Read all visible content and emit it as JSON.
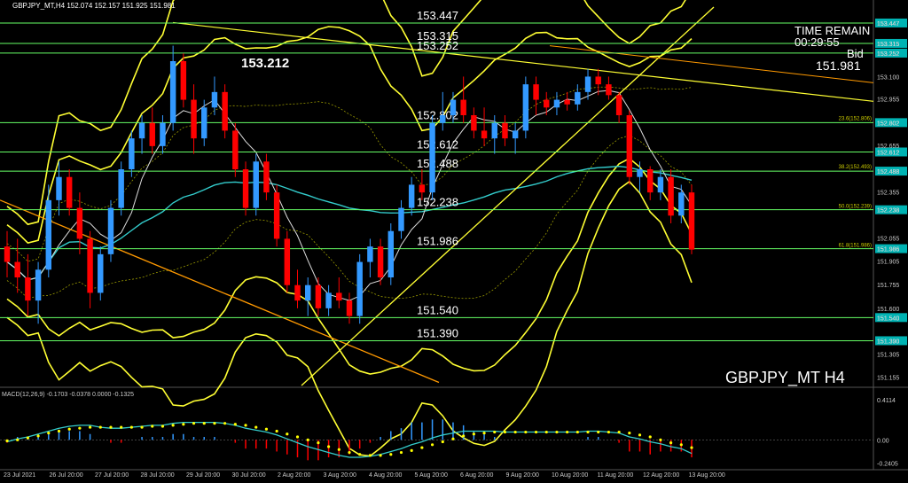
{
  "header": {
    "symbol_line": "GBPJPY_MT,H4  152.074 152.157 151.925 151.981"
  },
  "overlay": {
    "time_remain_label": "TIME REMAIN",
    "time_remain_value": "00:29:55",
    "bid_label": "Bid",
    "bid_value": "151.981",
    "highlight_price": "153.212",
    "watermark": "GBPJPY_MT H4"
  },
  "macd_header": "MACD(12,26,9) -0.1703 -0.0378 0.0000 -0.1325",
  "colors": {
    "bull": "#3399ff",
    "bear": "#ff0000",
    "bollinger": "#ffff33",
    "ma_cyan": "#33cccc",
    "level_line": "#66ff66",
    "level_tag_bg": "#00b3b3",
    "trend_orange": "#ff9900",
    "macd_signal": "#ffff00"
  },
  "chart_data": [
    {
      "type": "candlestick",
      "title": "GBPJPY_MT H4",
      "ylim": [
        151.1,
        153.55
      ],
      "y_ticks": [
        "153.447",
        "153.315",
        "153.252",
        "153.100",
        "152.955",
        "152.802",
        "152.655",
        "152.612",
        "152.488",
        "152.355",
        "152.238",
        "152.055",
        "151.986",
        "151.905",
        "151.755",
        "151.600",
        "151.540",
        "151.390",
        "151.305",
        "151.155"
      ],
      "x_ticks": [
        "23 Jul 2021",
        "26 Jul 20:00",
        "27 Jul 20:00",
        "28 Jul 20:00",
        "29 Jul 20:00",
        "30 Jul 20:00",
        "2 Aug 20:00",
        "3 Aug 20:00",
        "4 Aug 20:00",
        "5 Aug 20:00",
        "6 Aug 20:00",
        "9 Aug 20:00",
        "10 Aug 20:00",
        "11 Aug 20:00",
        "12 Aug 20:00",
        "13 Aug 20:00"
      ],
      "price_levels": [
        {
          "price": 153.447,
          "label": "153.447"
        },
        {
          "price": 153.315,
          "label": "153.315"
        },
        {
          "price": 153.252,
          "label": "153.252"
        },
        {
          "price": 152.802,
          "label": "152.802"
        },
        {
          "price": 152.612,
          "label": "152.612"
        },
        {
          "price": 152.488,
          "label": "152.488"
        },
        {
          "price": 152.238,
          "label": "152.238"
        },
        {
          "price": 151.986,
          "label": "151.986"
        },
        {
          "price": 151.54,
          "label": "151.540"
        },
        {
          "price": 151.39,
          "label": "151.390"
        }
      ],
      "fib_labels": [
        {
          "price": 152.806,
          "label": "23.6(152.806)"
        },
        {
          "price": 152.493,
          "label": "38.2(152.493)"
        },
        {
          "price": 152.239,
          "label": "50.0(152.239)"
        },
        {
          "price": 151.986,
          "label": "61.8(151.986)"
        }
      ],
      "candles": [
        [
          152.0,
          152.1,
          151.8,
          151.9
        ],
        [
          151.9,
          152.05,
          151.7,
          151.8
        ],
        [
          151.8,
          151.95,
          151.55,
          151.65
        ],
        [
          151.65,
          151.9,
          151.5,
          151.85
        ],
        [
          151.85,
          152.4,
          151.8,
          152.3
        ],
        [
          152.3,
          152.55,
          152.2,
          152.45
        ],
        [
          152.45,
          152.5,
          152.2,
          152.25
        ],
        [
          152.25,
          152.35,
          151.95,
          152.05
        ],
        [
          152.05,
          152.1,
          151.6,
          151.7
        ],
        [
          151.7,
          152.0,
          151.65,
          151.95
        ],
        [
          151.95,
          152.3,
          151.9,
          152.25
        ],
        [
          152.25,
          152.55,
          152.2,
          152.5
        ],
        [
          152.5,
          152.75,
          152.45,
          152.7
        ],
        [
          152.7,
          152.85,
          152.6,
          152.8
        ],
        [
          152.8,
          152.9,
          152.6,
          152.65
        ],
        [
          152.65,
          152.85,
          152.6,
          152.8
        ],
        [
          152.8,
          153.3,
          152.75,
          153.2
        ],
        [
          153.2,
          153.25,
          152.9,
          152.95
        ],
        [
          152.95,
          153.05,
          152.6,
          152.7
        ],
        [
          152.7,
          152.95,
          152.65,
          152.9
        ],
        [
          152.9,
          153.1,
          152.85,
          153.0
        ],
        [
          153.0,
          153.05,
          152.7,
          152.75
        ],
        [
          152.75,
          152.8,
          152.45,
          152.5
        ],
        [
          152.5,
          152.55,
          152.2,
          152.25
        ],
        [
          152.25,
          152.6,
          152.2,
          152.55
        ],
        [
          152.55,
          152.6,
          152.3,
          152.35
        ],
        [
          152.35,
          152.4,
          152.0,
          152.05
        ],
        [
          152.05,
          152.1,
          151.7,
          151.75
        ],
        [
          151.75,
          151.85,
          151.6,
          151.65
        ],
        [
          151.65,
          151.8,
          151.55,
          151.75
        ],
        [
          151.75,
          151.8,
          151.55,
          151.6
        ],
        [
          151.6,
          151.75,
          151.55,
          151.7
        ],
        [
          151.7,
          151.8,
          151.6,
          151.65
        ],
        [
          151.65,
          151.7,
          151.5,
          151.55
        ],
        [
          151.55,
          151.95,
          151.5,
          151.9
        ],
        [
          151.9,
          152.05,
          151.8,
          152.0
        ],
        [
          152.0,
          152.05,
          151.75,
          151.8
        ],
        [
          151.8,
          152.15,
          151.75,
          152.1
        ],
        [
          152.1,
          152.3,
          152.05,
          152.25
        ],
        [
          152.25,
          152.45,
          152.2,
          152.4
        ],
        [
          152.4,
          152.5,
          152.3,
          152.35
        ],
        [
          152.35,
          152.85,
          152.3,
          152.8
        ],
        [
          152.8,
          153.0,
          152.75,
          152.85
        ],
        [
          152.85,
          153.0,
          152.8,
          152.95
        ],
        [
          152.95,
          153.1,
          152.8,
          152.85
        ],
        [
          152.85,
          152.9,
          152.7,
          152.75
        ],
        [
          152.75,
          152.9,
          152.65,
          152.7
        ],
        [
          152.7,
          152.85,
          152.6,
          152.8
        ],
        [
          152.8,
          152.85,
          152.65,
          152.7
        ],
        [
          152.7,
          152.8,
          152.6,
          152.75
        ],
        [
          152.75,
          153.1,
          152.7,
          153.05
        ],
        [
          153.05,
          153.1,
          152.85,
          152.95
        ],
        [
          152.95,
          153.0,
          152.85,
          152.9
        ],
        [
          152.9,
          153.0,
          152.85,
          152.95
        ],
        [
          152.95,
          153.0,
          152.88,
          152.92
        ],
        [
          152.92,
          153.05,
          152.88,
          153.0
        ],
        [
          153.0,
          153.15,
          152.95,
          153.1
        ],
        [
          153.1,
          153.15,
          152.98,
          153.05
        ],
        [
          153.05,
          153.1,
          152.95,
          152.98
        ],
        [
          152.98,
          153.0,
          152.8,
          152.85
        ],
        [
          152.85,
          152.88,
          152.4,
          152.45
        ],
        [
          152.45,
          152.55,
          152.35,
          152.5
        ],
        [
          152.5,
          152.52,
          152.3,
          152.35
        ],
        [
          152.35,
          152.5,
          152.3,
          152.45
        ],
        [
          152.45,
          152.5,
          152.15,
          152.2
        ],
        [
          152.2,
          152.4,
          152.15,
          152.35
        ],
        [
          152.35,
          152.4,
          151.95,
          151.98
        ]
      ]
    },
    {
      "type": "bar",
      "title": "MACD(12,26,9)",
      "ylim": [
        -0.28,
        0.45
      ],
      "y_ticks": [
        "0.4114",
        "0.00",
        "-0.2405"
      ],
      "macd_line": [
        -0.02,
        0.01,
        0.03,
        0.06,
        0.09,
        0.12,
        0.14,
        0.15,
        0.15,
        0.13,
        0.12,
        0.12,
        0.13,
        0.14,
        0.15,
        0.15,
        0.17,
        0.18,
        0.18,
        0.18,
        0.18,
        0.17,
        0.15,
        0.12,
        0.1,
        0.08,
        0.05,
        0.01,
        -0.03,
        -0.07,
        -0.1,
        -0.13,
        -0.16,
        -0.18,
        -0.18,
        -0.17,
        -0.15,
        -0.12,
        -0.09,
        -0.05,
        -0.02,
        0.02,
        0.05,
        0.07,
        0.09,
        0.09,
        0.09,
        0.09,
        0.08,
        0.08,
        0.08,
        0.08,
        0.08,
        0.08,
        0.08,
        0.08,
        0.09,
        0.09,
        0.08,
        0.07,
        0.03,
        0.01,
        -0.02,
        -0.04,
        -0.07,
        -0.09,
        -0.14
      ],
      "signal_line": [
        -0.01,
        0.0,
        0.02,
        0.04,
        0.07,
        0.09,
        0.11,
        0.12,
        0.13,
        0.13,
        0.13,
        0.13,
        0.13,
        0.13,
        0.14,
        0.14,
        0.15,
        0.16,
        0.17,
        0.17,
        0.17,
        0.17,
        0.16,
        0.15,
        0.13,
        0.11,
        0.09,
        0.06,
        0.03,
        0.0,
        -0.03,
        -0.07,
        -0.1,
        -0.13,
        -0.15,
        -0.16,
        -0.16,
        -0.15,
        -0.13,
        -0.11,
        -0.08,
        -0.05,
        -0.02,
        0.01,
        0.04,
        0.06,
        0.07,
        0.08,
        0.08,
        0.08,
        0.08,
        0.08,
        0.08,
        0.08,
        0.08,
        0.08,
        0.08,
        0.08,
        0.08,
        0.08,
        0.07,
        0.05,
        0.03,
        0.0,
        -0.03,
        -0.05,
        -0.08
      ],
      "histogram": [
        -0.01,
        0.01,
        0.01,
        0.02,
        0.02,
        0.03,
        0.03,
        0.03,
        0.02,
        0.0,
        -0.01,
        -0.01,
        0.0,
        0.01,
        0.01,
        0.01,
        0.02,
        0.02,
        0.01,
        0.01,
        0.01,
        0.0,
        -0.01,
        -0.03,
        -0.03,
        -0.03,
        -0.04,
        -0.05,
        -0.06,
        -0.07,
        -0.07,
        -0.06,
        -0.06,
        -0.05,
        -0.03,
        -0.01,
        0.01,
        0.03,
        0.04,
        0.06,
        0.06,
        0.07,
        0.07,
        0.06,
        0.05,
        0.03,
        0.02,
        0.01,
        0.0,
        0.0,
        0.0,
        0.0,
        0.0,
        0.0,
        0.0,
        0.0,
        0.01,
        0.01,
        0.0,
        -0.01,
        -0.04,
        -0.04,
        -0.05,
        -0.04,
        -0.04,
        -0.04,
        -0.06
      ]
    }
  ]
}
